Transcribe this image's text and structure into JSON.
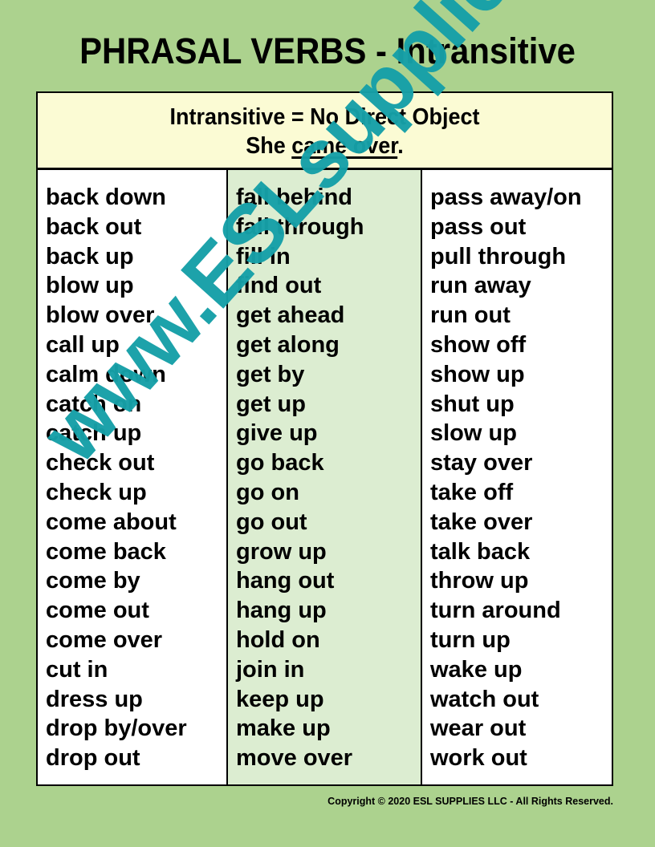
{
  "title": "PHRASAL VERBS - Intransitive",
  "header": {
    "definition": "Intransitive = No Direct Object",
    "example_prefix": "She ",
    "example_underlined": "came over",
    "example_suffix": "."
  },
  "columns": [
    {
      "items": [
        "back down",
        "back out",
        "back up",
        "blow up",
        "blow over",
        "call up",
        "calm down",
        "catch on",
        "catch up",
        "check out",
        "check up",
        "come about",
        "come back",
        "come by",
        "come out",
        "come over",
        "cut in",
        "dress up",
        "drop by/over",
        "drop out"
      ],
      "background": "#ffffff"
    },
    {
      "items": [
        "fall behind",
        "fall through",
        "fill in",
        "find out",
        "get ahead",
        "get along",
        "get by",
        "get up",
        "give up",
        "go back",
        "go on",
        "go out",
        "grow up",
        "hang out",
        "hang up",
        "hold on",
        "join in",
        "keep up",
        "make up",
        "move over"
      ],
      "background": "#dcedd1"
    },
    {
      "items": [
        "pass away/on",
        "pass out",
        "pull through",
        "run away",
        "run out",
        "show off",
        "show up",
        "shut up",
        "slow up",
        "stay over",
        "take off",
        "take over",
        "talk back",
        "throw up",
        "turn around",
        "turn up",
        "wake up",
        "watch out",
        "wear out",
        "work out"
      ],
      "background": "#ffffff"
    }
  ],
  "watermark": "www.ESLsupplies.com",
  "copyright": "Copyright © 2020 ESL SUPPLIES LLC - All Rights Reserved.",
  "colors": {
    "page_background": "#acd28e",
    "header_background": "#fbfbd4",
    "middle_column_background": "#dcedd1",
    "watermark": "#16a0a8"
  }
}
